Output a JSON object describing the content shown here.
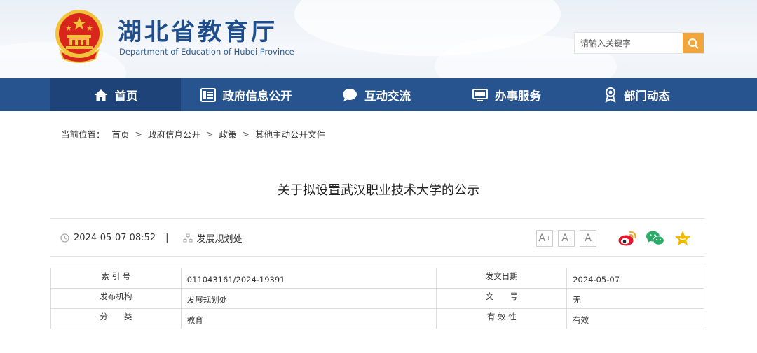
{
  "header": {
    "title": "湖北省教育厅",
    "subtitle": "Department of Education of Hubei Province",
    "search_placeholder": "请输入关键字"
  },
  "nav": {
    "items": [
      {
        "label": "首页",
        "icon": "home-icon",
        "active": true
      },
      {
        "label": "政府信息公开",
        "icon": "document-list-icon",
        "active": false
      },
      {
        "label": "互动交流",
        "icon": "chat-bubble-icon",
        "active": false
      },
      {
        "label": "办事服务",
        "icon": "monitor-icon",
        "active": false
      },
      {
        "label": "部门动态",
        "icon": "award-icon",
        "active": false
      }
    ]
  },
  "breadcrumb": {
    "prefix": "当前位置：",
    "items": [
      "首页",
      "政府信息公开",
      "政策",
      "其他主动公开文件"
    ],
    "separator": ">"
  },
  "article": {
    "title": "关于拟设置武汉职业技术大学的公示",
    "datetime": "2024-05-07 08:52",
    "divider": "|",
    "department": "发展规划处"
  },
  "toolbar": {
    "font_large": "A",
    "font_large_sup": "+",
    "font_small": "A",
    "font_small_sup": "-",
    "font_default": "A",
    "share_icons": [
      "weibo-icon",
      "wechat-icon",
      "favorite-star-icon"
    ]
  },
  "info_table": {
    "rows": [
      {
        "label1": "索 引 号",
        "value1": "011043161/2024-19391",
        "label2": "发文日期",
        "value2": "2024-05-07"
      },
      {
        "label1": "发布机构",
        "value1": "发展规划处",
        "label2": "文　　号",
        "value2": "无"
      },
      {
        "label1": "分　　类",
        "value1": "教育",
        "label2": "有 效 性",
        "value2": "有效"
      }
    ]
  },
  "colors": {
    "nav_bg": "#27538f",
    "nav_active_bg": "#1d4378",
    "title_blue": "#1f4e8c",
    "search_btn": "#f0a53d",
    "weibo_red": "#e6162d",
    "wechat_green": "#2aae67",
    "star_yellow": "#f5b800"
  }
}
